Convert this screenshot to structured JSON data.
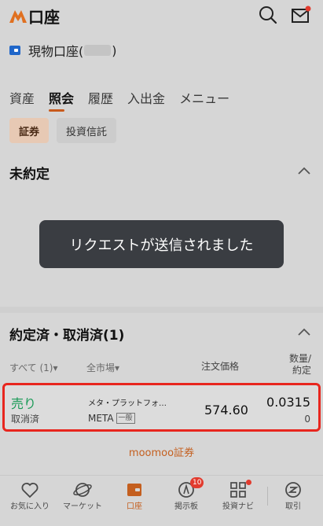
{
  "header": {
    "title": "口座"
  },
  "account": {
    "label_prefix": "現物口座(",
    "label_suffix": ")"
  },
  "tabs": [
    {
      "label": "資産",
      "active": false
    },
    {
      "label": "照会",
      "active": true
    },
    {
      "label": "履歴",
      "active": false
    },
    {
      "label": "入出金",
      "active": false
    },
    {
      "label": "メニュー",
      "active": false
    }
  ],
  "chips": [
    {
      "label": "証券",
      "active": true
    },
    {
      "label": "投資信託",
      "active": false
    }
  ],
  "unsettled": {
    "title": "未約定"
  },
  "toast": {
    "message": "リクエストが送信されました"
  },
  "settled": {
    "title": "約定済・取消済(1)",
    "filter_all": "すべて (1)▾",
    "filter_market": "全市場▾",
    "col_price": "注文価格",
    "col_qty_line1": "数量/",
    "col_qty_line2": "約定"
  },
  "order": {
    "side": "売り",
    "status": "取消済",
    "stock_name": "メタ・プラットフォ…",
    "ticker": "META",
    "account_type": "一般",
    "price": "574.60",
    "quantity": "0.0315",
    "filled": "0"
  },
  "footer": {
    "brand": "moomoo証券"
  },
  "bottom_nav": [
    {
      "label": "お気に入り",
      "icon": "heart-icon"
    },
    {
      "label": "マーケット",
      "icon": "planet-icon"
    },
    {
      "label": "口座",
      "icon": "wallet-icon",
      "active": true
    },
    {
      "label": "掲示板",
      "icon": "community-icon",
      "badge": "10"
    },
    {
      "label": "投資ナビ",
      "icon": "grid-icon"
    },
    {
      "label": "取引",
      "icon": "trade-icon"
    }
  ],
  "colors": {
    "accent": "#c45f1f",
    "sell": "#1a9a57",
    "highlight_border": "#e8261e"
  }
}
